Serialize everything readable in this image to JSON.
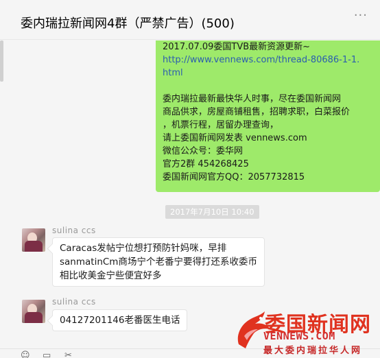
{
  "header": {
    "title": "委内瑞拉新闻网4群（严禁广告）(500)",
    "more_icon": "more-icon"
  },
  "messages": {
    "self": {
      "lines": [
        "2017.07.09委国TVB最新资源更新~",
        "http://www.vennews.com/thread-80686-1-1.",
        "html",
        "",
        "委内瑞拉最新最快华人时事，尽在委国新闻网",
        "商品供求，房屋商铺租售，招聘求职，白菜报价",
        "，机票行程，居留办理查询，",
        "请上委国新闻网发表 vennews.com",
        "微信公众号：委华网",
        "官方2群 454268425",
        "委国新闻网官方QQ：2057732815"
      ]
    },
    "timestamp": "2017年7月10日  10:40",
    "other": [
      {
        "sender": "sulina ccs",
        "lines": [
          "Caracas发帖宁位想打预防针妈咪，早排",
          "sanmatinCm商场宁个老番宁要得打还系收委币",
          "相比收美金宁些便宜好多"
        ]
      },
      {
        "sender": "sulina ccs",
        "lines": [
          "04127201146老番医生电话"
        ]
      }
    ]
  },
  "toolbar": {
    "icons": [
      "emoji-icon",
      "folder-icon",
      "scissors-icon"
    ]
  },
  "watermark": {
    "title_a": "委国",
    "title_b": "新闻网",
    "url": "VENNEWS.COM",
    "subtitle": "最大委内瑞拉华人网"
  },
  "colors": {
    "self_bubble": "#9eea6a",
    "link": "#2a5db0",
    "watermark_red": "#e0321f"
  }
}
